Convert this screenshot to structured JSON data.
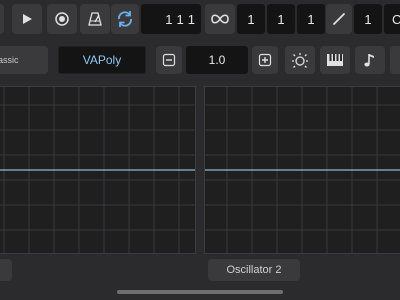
{
  "transport": {
    "position_bars": "1",
    "position_beats": "1",
    "position_ticks": "1",
    "loop_start": "1",
    "loop_beat": "1",
    "loop_tick": "1",
    "tempo_value": "1",
    "cut_label": "C"
  },
  "preset": {
    "category_label": "assic",
    "name": "VAPoly",
    "value": "1.0"
  },
  "bottom": {
    "left_tab_label": "",
    "right_tab_label": "Oscillator 2"
  },
  "colors": {
    "background": "#2b2b2d",
    "lcd": "#141414",
    "accent_blue": "#6ab0f0",
    "waveform": "#8fb8dc",
    "grid": "#3a3a3c"
  },
  "icons": {
    "play": "play-icon",
    "record": "record-icon",
    "metronome": "metronome-icon",
    "loop": "loop-icon",
    "infinity": "infinity-icon",
    "slash": "pencil-icon",
    "minus": "minus-icon",
    "plus": "plus-icon",
    "brightness": "brightness-icon",
    "keyboard": "piano-keyboard-icon",
    "note": "music-note-icon"
  }
}
